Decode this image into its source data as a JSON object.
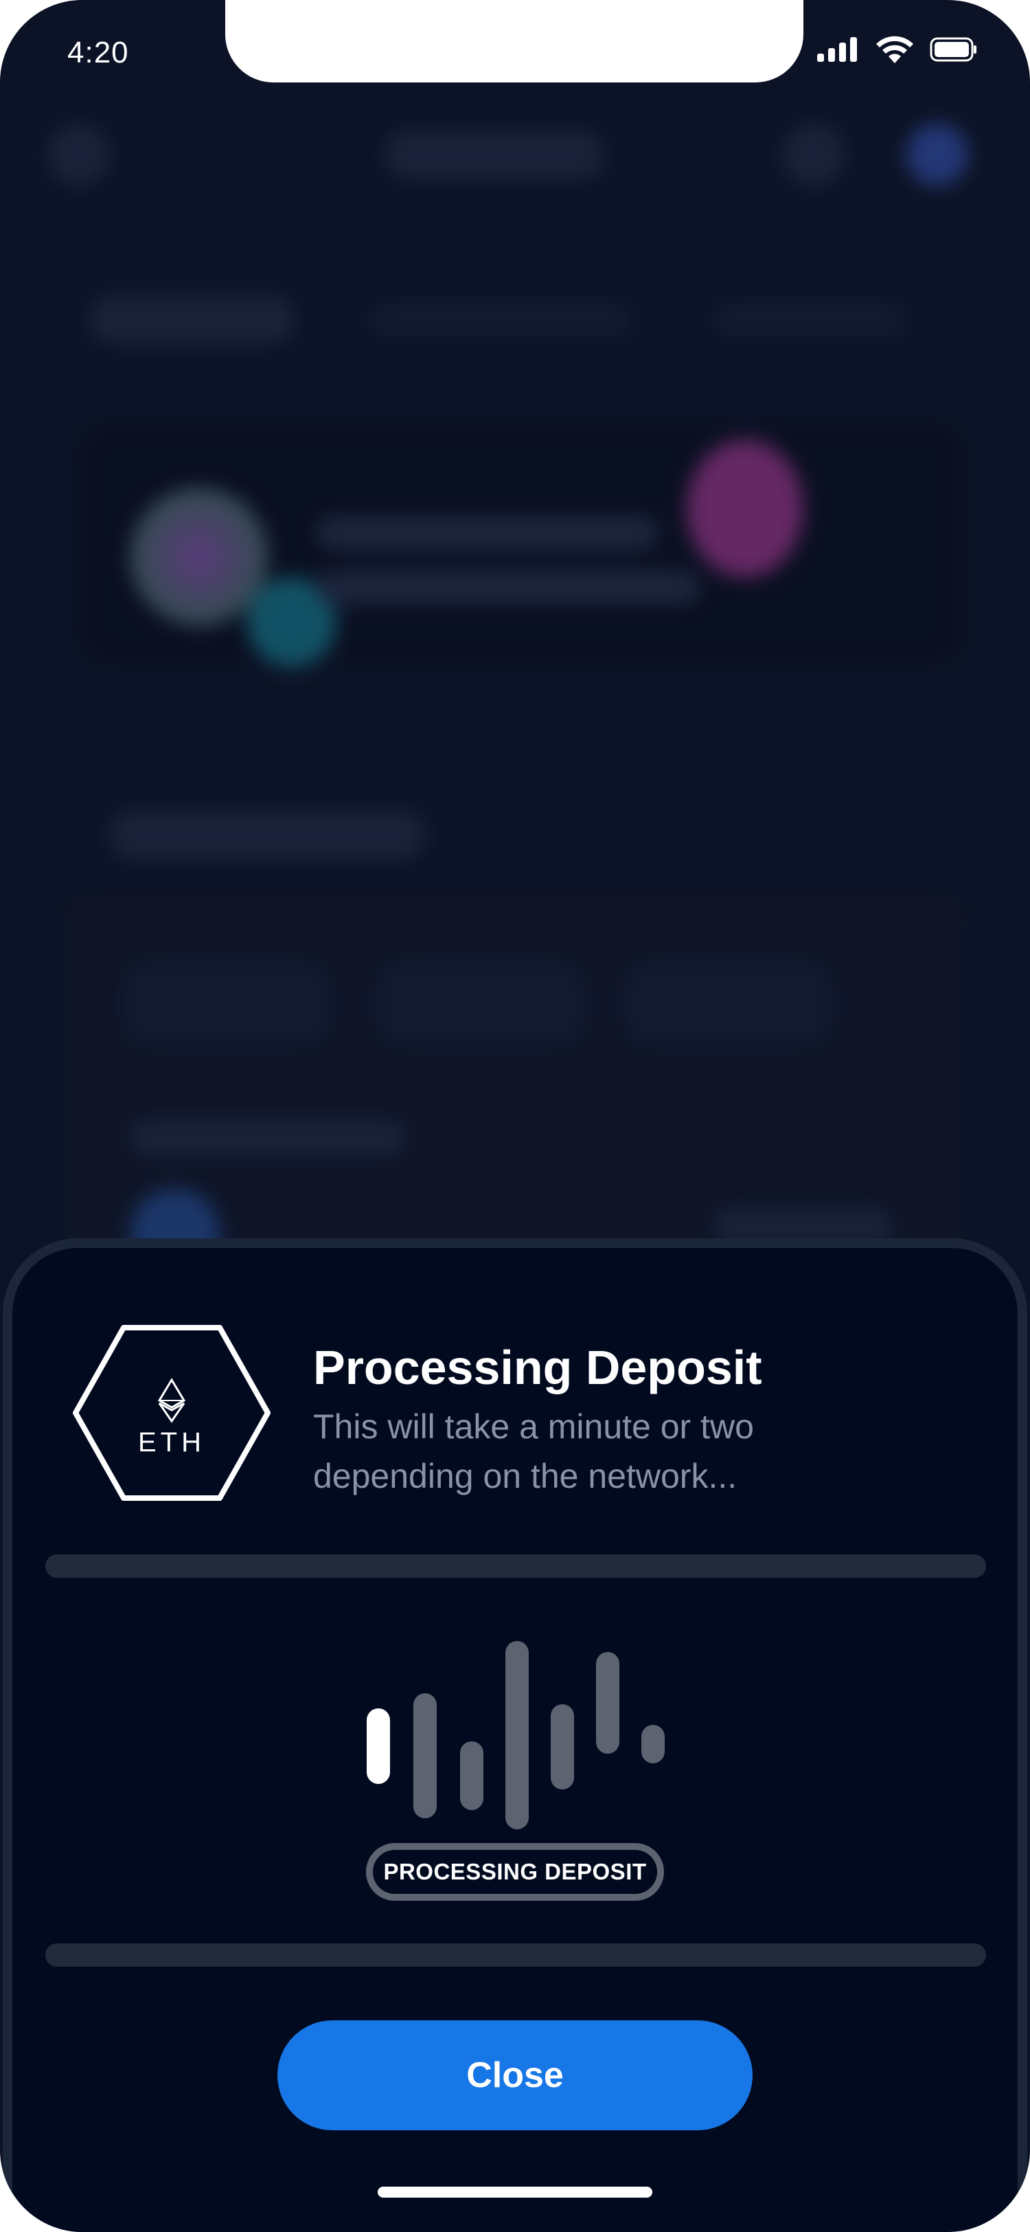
{
  "status_bar": {
    "time": "4:20"
  },
  "sheet": {
    "token_label": "ETH",
    "title": "Processing Deposit",
    "subtitle": "This will take a minute or two depending on the network...",
    "status_pill": "PROCESSING DEPOSIT",
    "close_label": "Close"
  },
  "colors": {
    "sheet_background": "#020a1f",
    "accent": "#1877e6",
    "bar_inactive": "#5d6371",
    "bar_active": "#ffffff"
  }
}
